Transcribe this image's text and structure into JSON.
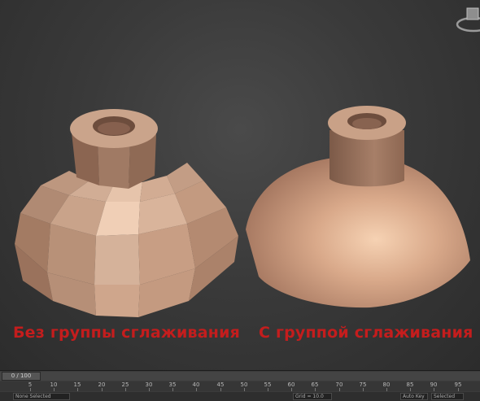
{
  "viewport": {
    "caption_left": "Без группы сглаживания",
    "caption_right": "С группой сглаживания",
    "caption_color": "#c41d1d"
  },
  "viewcube": {
    "icon": "viewcube-icon"
  },
  "timeline": {
    "frame_counter": "0 / 100",
    "ticks": [
      "5",
      "10",
      "15",
      "20",
      "25",
      "30",
      "35",
      "40",
      "45",
      "50",
      "55",
      "60",
      "65",
      "70",
      "75",
      "80",
      "85",
      "90",
      "95"
    ]
  },
  "status_bar": {
    "selection": "None Selected",
    "grid": "Grid = 10.0",
    "key_mode": "Auto Key",
    "selected": "Selected"
  }
}
